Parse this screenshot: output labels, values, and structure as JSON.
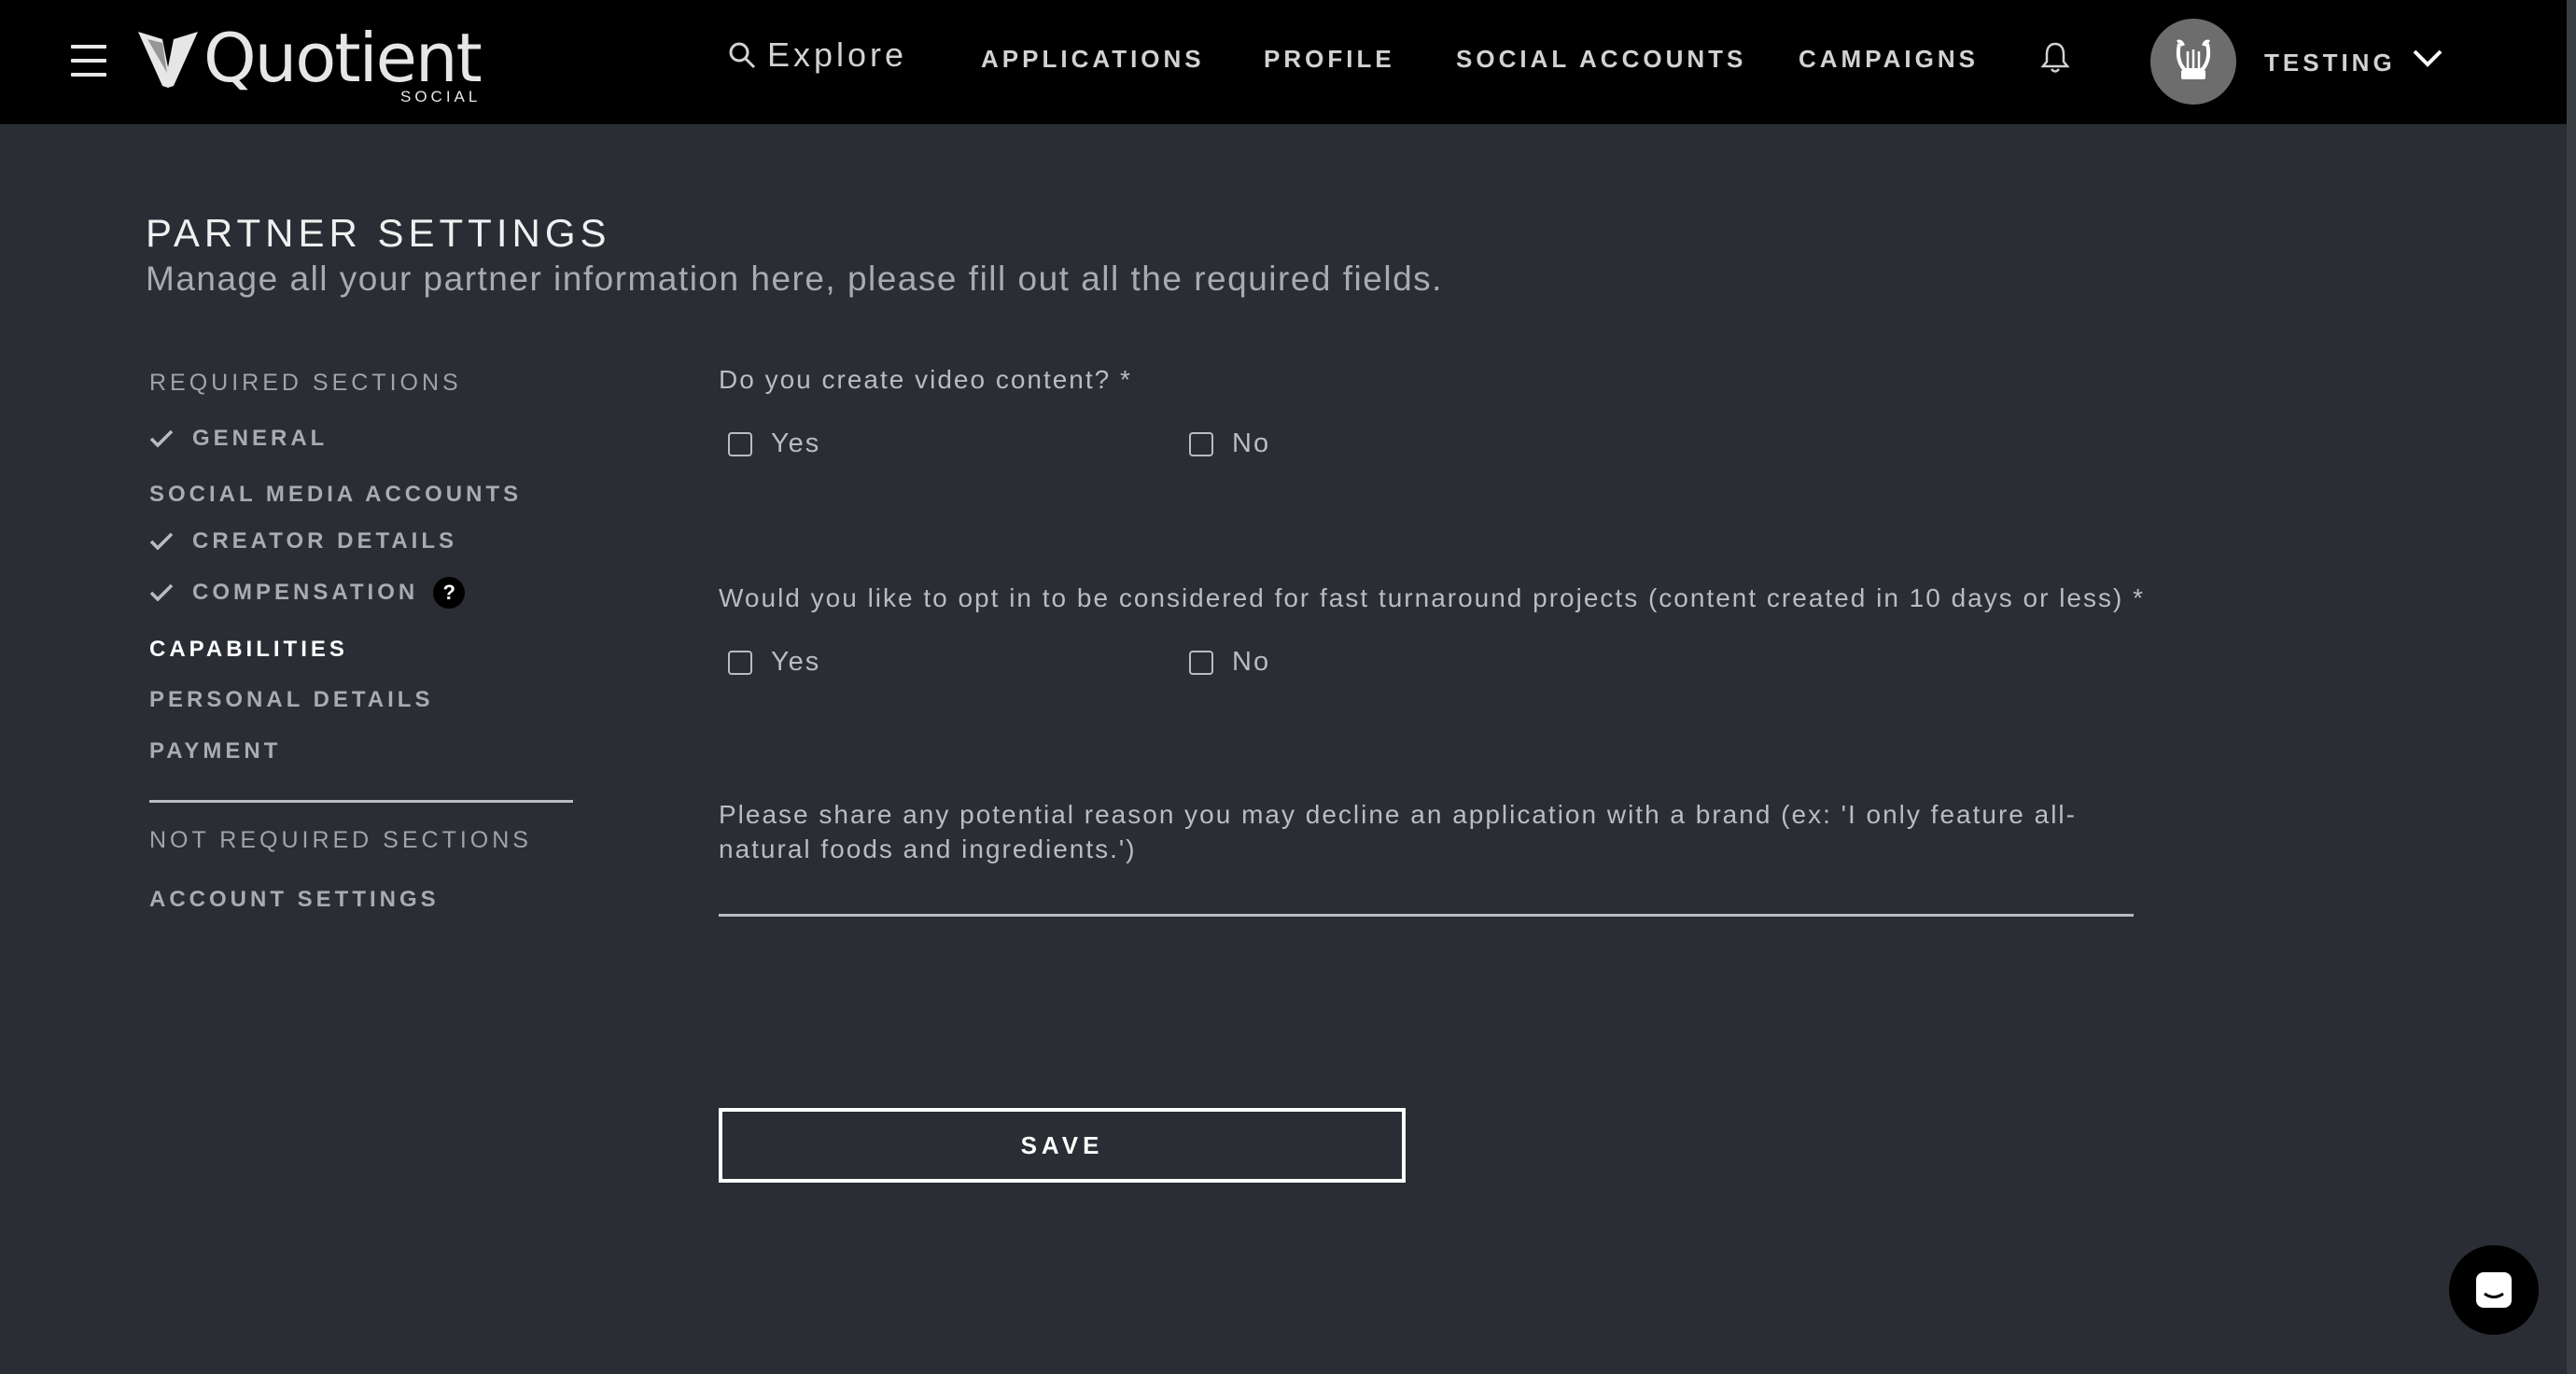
{
  "header": {
    "logo_text": "Quotient",
    "logo_subtext": "SOCIAL",
    "explore_label": "Explore",
    "nav": [
      "APPLICATIONS",
      "PROFILE",
      "SOCIAL ACCOUNTS",
      "CAMPAIGNS"
    ],
    "user_name": "TESTING"
  },
  "page": {
    "title": "PARTNER SETTINGS",
    "subtitle": "Manage all your partner information here, please fill out all the required fields."
  },
  "sidebar": {
    "required_heading": "REQUIRED SECTIONS",
    "required_items": [
      {
        "label": "GENERAL",
        "completed": true
      },
      {
        "label": "SOCIAL MEDIA ACCOUNTS",
        "completed": false
      },
      {
        "label": "CREATOR DETAILS",
        "completed": true
      },
      {
        "label": "COMPENSATION",
        "completed": true,
        "help": "?"
      },
      {
        "label": "CAPABILITIES",
        "completed": false,
        "active": true
      },
      {
        "label": "PERSONAL DETAILS",
        "completed": false
      },
      {
        "label": "PAYMENT",
        "completed": false
      }
    ],
    "not_required_heading": "NOT REQUIRED SECTIONS",
    "not_required_items": [
      {
        "label": "ACCOUNT SETTINGS"
      }
    ]
  },
  "form": {
    "q1": {
      "label": "Do you create video content? *",
      "options": [
        "Yes",
        "No"
      ]
    },
    "q2": {
      "label": "Would you like to opt in to be considered for fast turnaround projects (content created in 10 days or less) *",
      "options": [
        "Yes",
        "No"
      ]
    },
    "q3": {
      "label": "Please share any potential reason you may decline an application with a brand (ex: 'I only feature all-natural foods and ingredients.')",
      "value": ""
    },
    "save_label": "SAVE"
  },
  "colors": {
    "background": "#2a2d33",
    "topbar": "#000000",
    "text_muted": "#b9bcc1",
    "text_active": "#ffffff"
  }
}
